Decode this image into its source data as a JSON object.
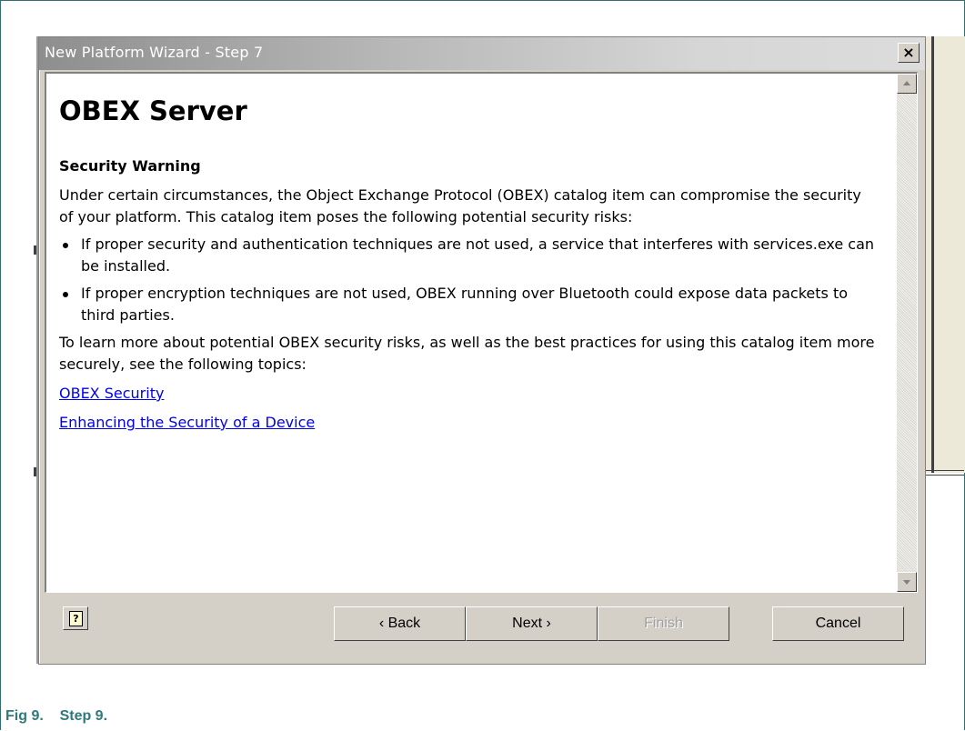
{
  "window": {
    "title": "New Platform Wizard - Step 7",
    "close_label": "×"
  },
  "content": {
    "heading": "OBEX Server",
    "subheading": "Security Warning",
    "intro": "Under certain circumstances, the Object Exchange Protocol (OBEX) catalog item can compromise the security of your platform. This catalog item poses the following potential security risks:",
    "bullets": [
      "If proper security and authentication techniques are not used, a service that interferes with services.exe can be installed.",
      "If proper encryption techniques are not used, OBEX running over Bluetooth could expose data packets to third parties."
    ],
    "outro": "To learn more about potential OBEX security risks, as well as the best practices for using this catalog item more securely, see the following topics:",
    "links": [
      "OBEX Security",
      "Enhancing the Security of a Device"
    ]
  },
  "buttons": {
    "help_glyph": "?",
    "back": "‹ Back",
    "next": "Next ›",
    "finish": "Finish",
    "cancel": "Cancel"
  },
  "caption": {
    "text": "Fig 9.    Step 9."
  },
  "colors": {
    "link": "#0000ee",
    "caption": "#2f7a7a",
    "dialog_face": "#d4d0c8"
  },
  "icons": {
    "close": "close-icon",
    "help": "help-icon",
    "scroll_up": "scroll-up-arrow-icon",
    "scroll_down": "scroll-down-arrow-icon",
    "bullet": "bullet-dot-icon"
  }
}
